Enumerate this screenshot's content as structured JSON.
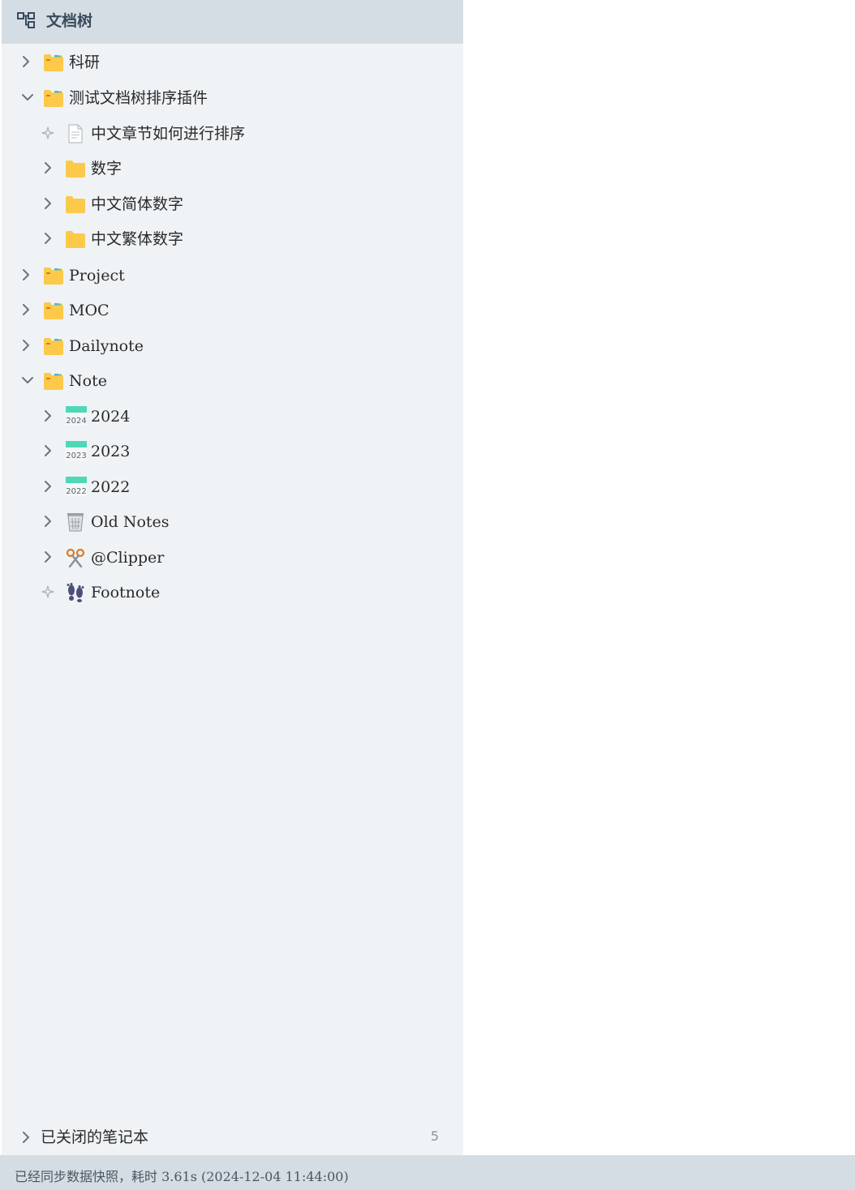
{
  "panel": {
    "title": "文档树",
    "icon": "tree-structure-icon"
  },
  "tree": [
    {
      "label": "科研",
      "icon": "notebook-folder-icon",
      "expanded": false
    },
    {
      "label": "测试文档树排序插件",
      "icon": "notebook-folder-icon",
      "expanded": true
    },
    {
      "label": "中文章节如何进行排序",
      "icon": "document-icon",
      "leaf": true
    },
    {
      "label": "数字",
      "icon": "folder-icon",
      "expanded": false
    },
    {
      "label": "中文简体数字",
      "icon": "folder-icon",
      "expanded": false
    },
    {
      "label": "中文繁体数字",
      "icon": "folder-icon",
      "expanded": false
    },
    {
      "label": "Project",
      "icon": "notebook-folder-icon",
      "expanded": false
    },
    {
      "label": "MOC",
      "icon": "notebook-folder-icon",
      "expanded": false
    },
    {
      "label": "Dailynote",
      "icon": "notebook-folder-icon",
      "expanded": false
    },
    {
      "label": "Note",
      "icon": "notebook-folder-icon",
      "expanded": true
    },
    {
      "label": "2024",
      "icon": "calendar-2024-icon",
      "icon_text": "2024",
      "expanded": false
    },
    {
      "label": "2023",
      "icon": "calendar-2023-icon",
      "icon_text": "2023",
      "expanded": false
    },
    {
      "label": "2022",
      "icon": "calendar-2022-icon",
      "icon_text": "2022",
      "expanded": false
    },
    {
      "label": "Old Notes",
      "icon": "trash-bin-icon",
      "expanded": false
    },
    {
      "label": "@Clipper",
      "icon": "scissors-icon",
      "expanded": false
    },
    {
      "label": "Footnote",
      "icon": "footprints-icon",
      "leaf": true
    }
  ],
  "closed_notebooks": {
    "label": "已关闭的笔记本",
    "count": "5"
  },
  "status_bar": {
    "text": "已经同步数据快照，耗时 3.61s (2024-12-04 11:44:00)"
  },
  "colors": {
    "sidebar_bg": "#eff3f6",
    "header_bg": "#d4dde3",
    "folder_yellow": "#fcc94b",
    "calendar_teal": "#4fd8b8"
  }
}
